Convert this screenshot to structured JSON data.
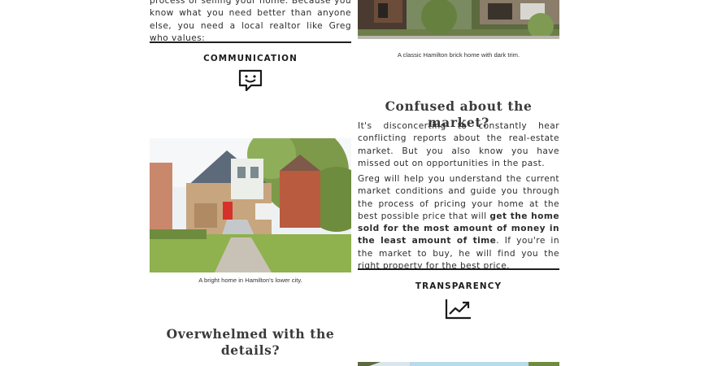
{
  "intro": {
    "text": "process of selling your home. Because you know what you need better than anyone else, you need a local realtor like Greg who values:"
  },
  "values": [
    {
      "heading": "COMMUNICATION",
      "icon": "chat-bubble-smile-icon"
    },
    {
      "heading": "TRANSPARENCY",
      "icon": "trending-up-chart-icon"
    }
  ],
  "photos": [
    {
      "caption": "A classic Hamilton brick home with dark trim."
    },
    {
      "caption": "A bright home in Hamilton's lower city."
    }
  ],
  "market_section": {
    "title": "Confused about the market?",
    "para1": "It's disconcerting to constantly hear conflicting reports about the real-estate market. But you also know you have missed out on opportunities in the past.",
    "para2_start": "Greg will help you understand the current market conditions and guide you through the process of pricing your home at the best possible price that will ",
    "para2_bold": "get the home sold for the most amount of money in the least amount of time",
    "para2_end": ". If you're in the market to buy, he will find you the right property for the best price."
  },
  "details_section": {
    "title": "Overwhelmed with the details?"
  },
  "colors": {
    "text": "#2d2d2d",
    "heading": "#3a3a3a",
    "rule": "#1f1f1f",
    "background": "#ffffff"
  }
}
